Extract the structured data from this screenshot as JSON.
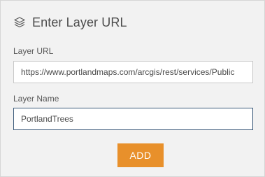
{
  "header": {
    "title": "Enter Layer URL",
    "icon": "layers-icon"
  },
  "form": {
    "url_label": "Layer URL",
    "url_value": "https://www.portlandmaps.com/arcgis/rest/services/Public",
    "name_label": "Layer Name",
    "name_value": "PortlandTrees"
  },
  "actions": {
    "add_label": "ADD"
  },
  "colors": {
    "accent": "#e8902b",
    "panel_bg": "#f2f2f2",
    "focus_border": "#3b5a7a"
  }
}
